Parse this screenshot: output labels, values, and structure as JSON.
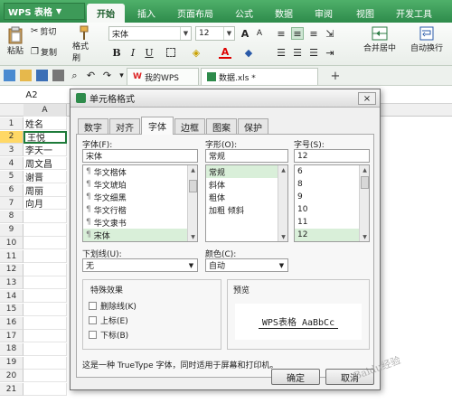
{
  "app": {
    "name": "WPS 表格"
  },
  "ribbon_tabs": [
    "开始",
    "插入",
    "页面布局",
    "公式",
    "数据",
    "审阅",
    "视图",
    "开发工具"
  ],
  "ribbon": {
    "cut": "剪切",
    "copy": "复制",
    "format_painter": "格式刷",
    "paste": "粘贴",
    "font_name": "宋体",
    "font_size": "12",
    "merge_center": "合并居中",
    "wrap_text": "自动换行",
    "bold": "B",
    "italic": "I",
    "underline": "U",
    "font_color": "A"
  },
  "doc_tabs": [
    "我的WPS",
    "数据.xls *"
  ],
  "add_tab": "+",
  "name_box": "A2",
  "col_header": "A",
  "sheet": {
    "rows": [
      {
        "num": "1",
        "value": "姓名"
      },
      {
        "num": "2",
        "value": "王悦"
      },
      {
        "num": "3",
        "value": "李天一"
      },
      {
        "num": "4",
        "value": "周文昌"
      },
      {
        "num": "5",
        "value": "谢晋"
      },
      {
        "num": "6",
        "value": "周丽"
      },
      {
        "num": "7",
        "value": "向月"
      },
      {
        "num": "8",
        "value": ""
      },
      {
        "num": "9",
        "value": ""
      },
      {
        "num": "10",
        "value": ""
      },
      {
        "num": "11",
        "value": ""
      },
      {
        "num": "12",
        "value": ""
      },
      {
        "num": "13",
        "value": ""
      },
      {
        "num": "14",
        "value": ""
      },
      {
        "num": "15",
        "value": ""
      },
      {
        "num": "16",
        "value": ""
      },
      {
        "num": "17",
        "value": ""
      },
      {
        "num": "18",
        "value": ""
      },
      {
        "num": "19",
        "value": ""
      },
      {
        "num": "20",
        "value": ""
      },
      {
        "num": "21",
        "value": ""
      }
    ]
  },
  "dialog": {
    "title": "单元格格式",
    "close": "×",
    "tabs": [
      "数字",
      "对齐",
      "字体",
      "边框",
      "图案",
      "保护"
    ],
    "active_tab": "字体",
    "font_label": "字体(F):",
    "font_value": "宋体",
    "fonts": [
      "华文楷体",
      "华文琥珀",
      "华文细黑",
      "华文行楷",
      "华文隶书",
      "宋体"
    ],
    "style_label": "字形(O):",
    "style_value": "常规",
    "styles": [
      "常规",
      "斜体",
      "粗体",
      "加粗 倾斜"
    ],
    "size_label": "字号(S):",
    "size_value": "12",
    "sizes": [
      "6",
      "8",
      "9",
      "10",
      "11",
      "12"
    ],
    "underline_label": "下划线(U):",
    "underline_value": "无",
    "color_label": "颜色(C):",
    "color_value": "自动",
    "effects_label": "特殊效果",
    "effects": [
      "删除线(K)",
      "上标(E)",
      "下标(B)"
    ],
    "preview_label": "预览",
    "preview_text": "WPS表格  AaBbCc",
    "note": "这是一种 TrueType 字体，同时适用于屏幕和打印机。",
    "ok": "确定",
    "cancel": "取消"
  },
  "watermark": "Baidu经验",
  "colors": {
    "brand": "#2e8b4b",
    "selected_row": "#ffd866",
    "list_selected": "#d9efd9"
  }
}
